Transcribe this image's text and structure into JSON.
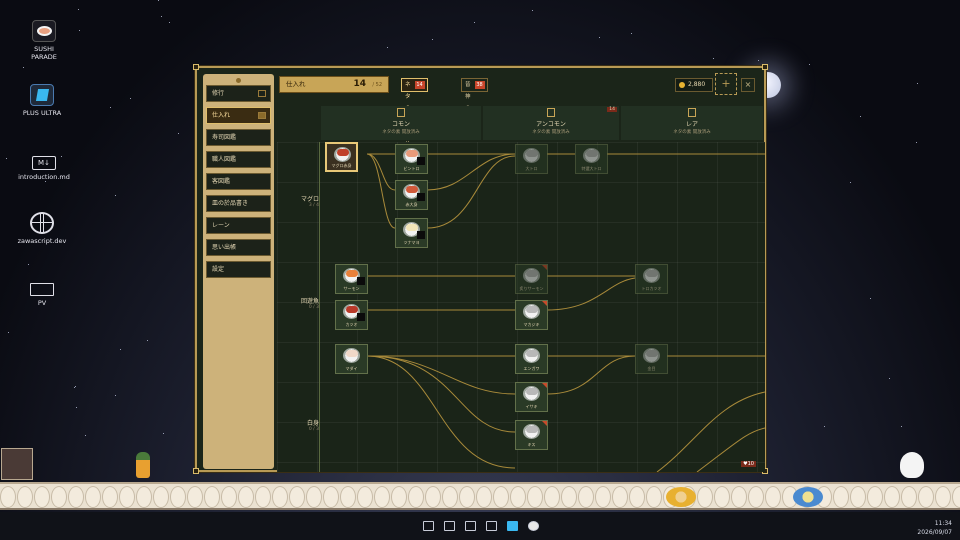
{
  "desktop": {
    "icons": [
      {
        "label": "SUSHI\nPARADE",
        "name": "sushi-parade-icon"
      },
      {
        "label": "PLUS ULTRA",
        "name": "plus-ultra-icon"
      },
      {
        "label": "introduction.md",
        "name": "markdown-file-icon"
      },
      {
        "label": "zawascript.dev",
        "name": "globe-icon"
      },
      {
        "label": "PV",
        "name": "folder-icon"
      }
    ]
  },
  "window": {
    "sidebar": [
      {
        "label": "修行",
        "active": false
      },
      {
        "label": "仕入れ",
        "active": true
      },
      {
        "label": "寿司図鑑",
        "active": false
      },
      {
        "label": "職人図鑑",
        "active": false
      },
      {
        "label": "客図鑑",
        "active": false
      },
      {
        "label": "皿の於品書き",
        "active": false
      },
      {
        "label": "レーン",
        "active": false
      },
      {
        "label": "思い出帳",
        "active": false
      },
      {
        "label": "設定",
        "active": false
      }
    ],
    "stock": {
      "label": "仕入れ",
      "value": "14",
      "denom": "/ 52"
    },
    "tabs": [
      {
        "label": "ネタの未開放",
        "count": "14",
        "on": true
      },
      {
        "label": "皆神の駆立",
        "count": "38",
        "on": false
      }
    ],
    "coins": "2,880",
    "plus": "+",
    "close": "×",
    "columns": [
      {
        "title": "コモン",
        "sub": "ネタの素 開放済み",
        "badge": ""
      },
      {
        "title": "アンコモン",
        "sub": "ネタの素 開放済み",
        "badge": "14"
      },
      {
        "title": "レア",
        "sub": "ネタの素 開放済み",
        "badge": ""
      }
    ],
    "rows": [
      {
        "label": "マグロ",
        "count": "3 / 4"
      },
      {
        "label": "回遊魚",
        "count": "0 / 3"
      },
      {
        "label": "白身",
        "count": "0 / 3"
      }
    ],
    "nodes": [
      {
        "label": "マグロ赤身",
        "fish": "#c0402a",
        "sel": true
      },
      {
        "label": "ビントロ",
        "fish": "#e89a7a"
      },
      {
        "label": "赤大身",
        "fish": "#d05a3a"
      },
      {
        "label": "ツナマヨ",
        "fish": "#f2e6b8"
      },
      {
        "label": "大トロ",
        "fish": "#b8b8b8",
        "dim": true
      },
      {
        "label": "特選大トロ",
        "fish": "#b8b8b8",
        "dim": true
      },
      {
        "label": "サーモン",
        "fish": "#e8803a"
      },
      {
        "label": "カツオ",
        "fish": "#b83a2a"
      },
      {
        "label": "炙りサーモン",
        "fish": "#b8b8b8",
        "dim": true
      },
      {
        "label": "マカジキ",
        "fish": "#b8b8b8"
      },
      {
        "label": "トロカツオ",
        "fish": "#b8b8b8",
        "dim": true
      },
      {
        "label": "マダイ",
        "fish": "#f0d8c8"
      },
      {
        "label": "エンガワ",
        "fish": "#b8b8b8"
      },
      {
        "label": "イサキ",
        "fish": "#b8b8b8"
      },
      {
        "label": "キス",
        "fish": "#b8b8b8"
      },
      {
        "label": "金目",
        "fish": "#b8b8b8",
        "dim": true
      }
    ],
    "footer_badge": "♥10"
  },
  "taskbar": {
    "time": "11:34",
    "date": "2026/09/07"
  }
}
